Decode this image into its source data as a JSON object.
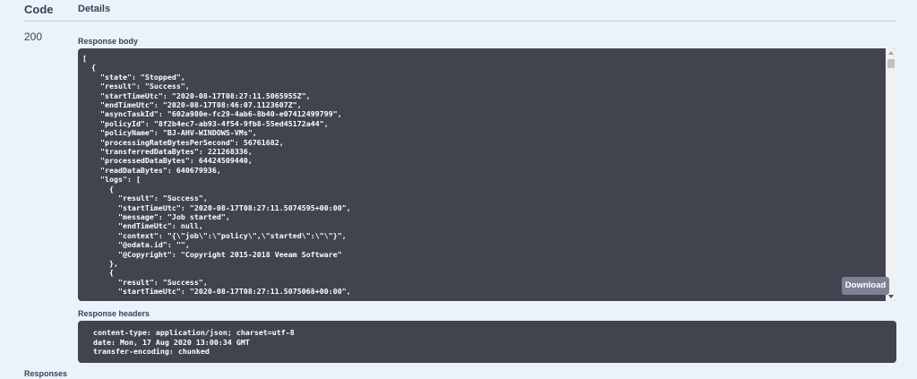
{
  "header": {
    "code_label": "Code",
    "details_label": "Details"
  },
  "response": {
    "status_code": "200",
    "body_label": "Response body",
    "body_lines": [
      "[",
      "  {",
      "    \"state\": \"Stopped\",",
      "    \"result\": \"Success\",",
      "    \"startTimeUtc\": \"2020-08-17T08:27:11.5065955Z\",",
      "    \"endTimeUtc\": \"2020-08-17T08:46:07.1123607Z\",",
      "    \"asyncTaskId\": \"602a980e-fc29-4ab6-8b40-e07412499799\",",
      "    \"policyId\": \"8f2b4ec7-ab93-4f54-9fb8-55ed45172a44\",",
      "    \"policyName\": \"BJ-AHV-WINDOWS-VMs\",",
      "    \"processingRateBytesPerSecond\": 56761682,",
      "    \"transferredDataBytes\": 221268336,",
      "    \"processedDataBytes\": 64424509440,",
      "    \"readDataBytes\": 640679936,",
      "    \"logs\": [",
      "      {",
      "        \"result\": \"Success\",",
      "        \"startTimeUtc\": \"2020-08-17T08:27:11.5074595+00:00\",",
      "        \"message\": \"Job started\",",
      "        \"endTimeUtc\": null,",
      "        \"context\": \"{\\\"job\\\":\\\"policy\\\",\\\"started\\\":\\\"\\\"}\",",
      "        \"@odata.id\": \"\",",
      "        \"@Copyright\": \"Copyright 2015-2018 Veeam Software\"",
      "      },",
      "      {",
      "        \"result\": \"Success\",",
      "        \"startTimeUtc\": \"2020-08-17T08:27:11.5075068+00:00\","
    ],
    "download_label": "Download",
    "headers_label": "Response headers",
    "header_lines": [
      " content-type: application/json; charset=utf-8 ",
      " date: Mon, 17 Aug 2020 13:00:34 GMT ",
      " transfer-encoding: chunked "
    ]
  },
  "footer": {
    "responses_label": "Responses"
  }
}
